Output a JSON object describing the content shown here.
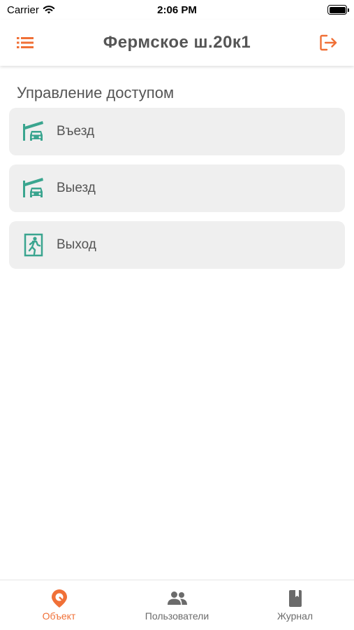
{
  "status": {
    "carrier": "Carrier",
    "time": "2:06 PM"
  },
  "nav": {
    "title": "Фермское ш.20к1",
    "menu_icon": "list-icon",
    "logout_icon": "logout-icon"
  },
  "section": {
    "title": "Управление доступом"
  },
  "items": [
    {
      "label": "Въезд",
      "icon": "barrier-car-icon"
    },
    {
      "label": "Выезд",
      "icon": "barrier-car-icon"
    },
    {
      "label": "Выход",
      "icon": "exit-door-icon"
    }
  ],
  "tabs": [
    {
      "label": "Объект",
      "icon": "location-pin-icon",
      "active": true
    },
    {
      "label": "Пользователи",
      "icon": "people-icon",
      "active": false
    },
    {
      "label": "Журнал",
      "icon": "book-icon",
      "active": false
    }
  ],
  "colors": {
    "accent": "#f07037",
    "icon_teal": "#3aa58f",
    "card_bg": "#efefef",
    "text": "#555555"
  }
}
